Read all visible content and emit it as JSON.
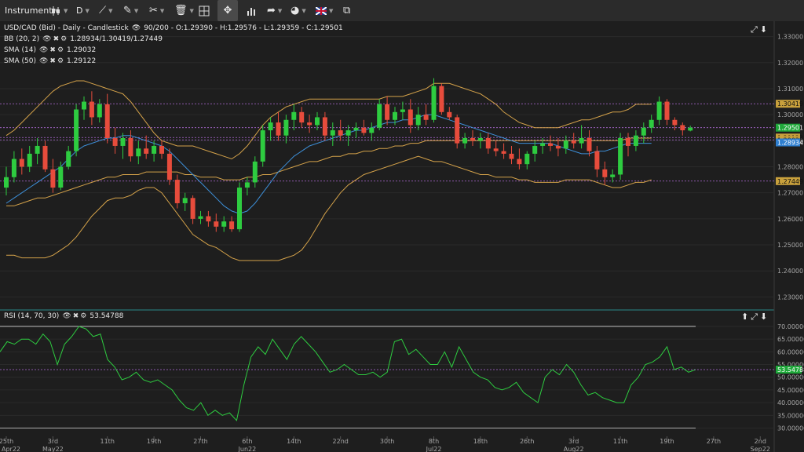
{
  "toolbar": {
    "instrument_label": "Instrument",
    "timeframe_label": "D"
  },
  "legend": {
    "main_title": "USD/CAD (Bid) - Daily - Candlestick",
    "main_values": "90/200 - O:1.29390 - H:1.29576 - L:1.29359 - C:1.29501",
    "bb_label": "BB (20, 2)",
    "bb_values": "1.28934/1.30419/1.27449",
    "sma14_label": "SMA (14)",
    "sma14_value": "1.29032",
    "sma50_label": "SMA (50)",
    "sma50_value": "1.29122",
    "rsi_label": "RSI (14, 70, 30)",
    "rsi_value": "53.54788"
  },
  "colors": {
    "background": "#1e1e1e",
    "up_candle": "#2ecc40",
    "down_candle": "#e74c3c",
    "bollinger": "#d4a24a",
    "sma14": "#3d8fd8",
    "sma50": "#d4a24a",
    "rsi_line": "#2ecc40",
    "price_level_line": "#b06ad8"
  },
  "chart_data": {
    "type": "candlestick",
    "title": "USD/CAD (Bid) - Daily - Candlestick",
    "price_axis": {
      "range": [
        1.225,
        1.335
      ],
      "ticks": [
        "1.33000",
        "1.32000",
        "1.31000",
        "1.30000",
        "1.29000",
        "1.28000",
        "1.27000",
        "1.26000",
        "1.25000",
        "1.24000",
        "1.23000"
      ]
    },
    "price_tags": [
      {
        "value": 1.30419,
        "label": "1.30419",
        "bg": "#c8a03c",
        "fg": "#111111"
      },
      {
        "value": 1.29501,
        "label": "1.29501",
        "bg": "#1fa83a",
        "fg": "#ffffff"
      },
      {
        "value": 1.29122,
        "label": "1.29122",
        "bg": "#c8a03c",
        "fg": "#111111"
      },
      {
        "value": 1.29032,
        "label": "1.29032",
        "bg": "#c8a03c",
        "fg": "#111111"
      },
      {
        "value": 1.28934,
        "label": "1.28934",
        "bg": "#2f7fd0",
        "fg": "#ffffff"
      },
      {
        "value": 1.27449,
        "label": "1.27449",
        "bg": "#c8a03c",
        "fg": "#111111"
      }
    ],
    "level_lines": [
      1.30419,
      1.29501,
      1.29122,
      1.29032,
      1.27449
    ],
    "candles": [
      [
        1.272,
        1.28,
        1.269,
        1.276
      ],
      [
        1.276,
        1.286,
        1.274,
        1.283
      ],
      [
        1.283,
        1.287,
        1.277,
        1.28
      ],
      [
        1.28,
        1.288,
        1.278,
        1.285
      ],
      [
        1.285,
        1.291,
        1.281,
        1.288
      ],
      [
        1.288,
        1.29,
        1.278,
        1.279
      ],
      [
        1.279,
        1.283,
        1.27,
        1.272
      ],
      [
        1.272,
        1.282,
        1.271,
        1.28
      ],
      [
        1.28,
        1.288,
        1.279,
        1.286
      ],
      [
        1.286,
        1.304,
        1.284,
        1.302
      ],
      [
        1.302,
        1.307,
        1.298,
        1.305
      ],
      [
        1.305,
        1.309,
        1.296,
        1.299
      ],
      [
        1.299,
        1.306,
        1.297,
        1.304
      ],
      [
        1.304,
        1.308,
        1.289,
        1.291
      ],
      [
        1.291,
        1.295,
        1.285,
        1.288
      ],
      [
        1.288,
        1.293,
        1.283,
        1.291
      ],
      [
        1.291,
        1.294,
        1.282,
        1.284
      ],
      [
        1.284,
        1.29,
        1.281,
        1.287
      ],
      [
        1.287,
        1.292,
        1.283,
        1.285
      ],
      [
        1.285,
        1.29,
        1.282,
        1.288
      ],
      [
        1.288,
        1.29,
        1.283,
        1.285
      ],
      [
        1.285,
        1.287,
        1.273,
        1.275
      ],
      [
        1.275,
        1.277,
        1.264,
        1.266
      ],
      [
        1.266,
        1.27,
        1.263,
        1.268
      ],
      [
        1.268,
        1.269,
        1.258,
        1.26
      ],
      [
        1.26,
        1.263,
        1.258,
        1.261
      ],
      [
        1.261,
        1.263,
        1.257,
        1.259
      ],
      [
        1.259,
        1.262,
        1.255,
        1.257
      ],
      [
        1.257,
        1.261,
        1.255,
        1.259
      ],
      [
        1.259,
        1.261,
        1.255,
        1.256
      ],
      [
        1.256,
        1.274,
        1.255,
        1.272
      ],
      [
        1.272,
        1.276,
        1.269,
        1.274
      ],
      [
        1.274,
        1.284,
        1.272,
        1.282
      ],
      [
        1.282,
        1.296,
        1.28,
        1.294
      ],
      [
        1.294,
        1.299,
        1.29,
        1.297
      ],
      [
        1.297,
        1.301,
        1.29,
        1.292
      ],
      [
        1.292,
        1.3,
        1.289,
        1.298
      ],
      [
        1.298,
        1.304,
        1.294,
        1.301
      ],
      [
        1.301,
        1.303,
        1.295,
        1.297
      ],
      [
        1.297,
        1.3,
        1.293,
        1.296
      ],
      [
        1.296,
        1.301,
        1.294,
        1.299
      ],
      [
        1.299,
        1.301,
        1.29,
        1.292
      ],
      [
        1.292,
        1.297,
        1.288,
        1.294
      ],
      [
        1.294,
        1.298,
        1.29,
        1.292
      ],
      [
        1.292,
        1.296,
        1.288,
        1.294
      ],
      [
        1.294,
        1.297,
        1.291,
        1.295
      ],
      [
        1.295,
        1.298,
        1.292,
        1.293
      ],
      [
        1.293,
        1.297,
        1.29,
        1.295
      ],
      [
        1.295,
        1.306,
        1.294,
        1.304
      ],
      [
        1.304,
        1.307,
        1.296,
        1.298
      ],
      [
        1.298,
        1.303,
        1.296,
        1.301
      ],
      [
        1.301,
        1.305,
        1.298,
        1.302
      ],
      [
        1.302,
        1.306,
        1.293,
        1.296
      ],
      [
        1.296,
        1.303,
        1.294,
        1.3
      ],
      [
        1.3,
        1.304,
        1.296,
        1.298
      ],
      [
        1.298,
        1.314,
        1.297,
        1.311
      ],
      [
        1.311,
        1.312,
        1.3,
        1.301
      ],
      [
        1.301,
        1.303,
        1.298,
        1.299
      ],
      [
        1.299,
        1.3,
        1.287,
        1.289
      ],
      [
        1.289,
        1.293,
        1.287,
        1.291
      ],
      [
        1.291,
        1.294,
        1.288,
        1.29
      ],
      [
        1.29,
        1.293,
        1.287,
        1.291
      ],
      [
        1.291,
        1.293,
        1.285,
        1.287
      ],
      [
        1.287,
        1.29,
        1.284,
        1.286
      ],
      [
        1.286,
        1.289,
        1.283,
        1.285
      ],
      [
        1.285,
        1.288,
        1.281,
        1.283
      ],
      [
        1.283,
        1.287,
        1.279,
        1.281
      ],
      [
        1.281,
        1.286,
        1.279,
        1.285
      ],
      [
        1.285,
        1.29,
        1.282,
        1.288
      ],
      [
        1.288,
        1.291,
        1.285,
        1.289
      ],
      [
        1.289,
        1.292,
        1.286,
        1.288
      ],
      [
        1.288,
        1.291,
        1.284,
        1.287
      ],
      [
        1.287,
        1.292,
        1.285,
        1.29
      ],
      [
        1.29,
        1.293,
        1.287,
        1.289
      ],
      [
        1.289,
        1.296,
        1.287,
        1.291
      ],
      [
        1.291,
        1.294,
        1.284,
        1.286
      ],
      [
        1.286,
        1.288,
        1.276,
        1.279
      ],
      [
        1.279,
        1.282,
        1.273,
        1.276
      ],
      [
        1.276,
        1.279,
        1.274,
        1.277
      ],
      [
        1.277,
        1.293,
        1.275,
        1.291
      ],
      [
        1.291,
        1.293,
        1.284,
        1.288
      ],
      [
        1.288,
        1.294,
        1.286,
        1.292
      ],
      [
        1.292,
        1.297,
        1.289,
        1.295
      ],
      [
        1.295,
        1.3,
        1.293,
        1.298
      ],
      [
        1.298,
        1.307,
        1.296,
        1.305
      ],
      [
        1.305,
        1.306,
        1.296,
        1.298
      ],
      [
        1.298,
        1.299,
        1.294,
        1.296
      ],
      [
        1.296,
        1.297,
        1.292,
        1.294
      ],
      [
        1.2939,
        1.29576,
        1.29359,
        1.29501
      ]
    ],
    "bollinger_upper": [
      1.292,
      1.294,
      1.297,
      1.3,
      1.303,
      1.306,
      1.309,
      1.311,
      1.312,
      1.313,
      1.313,
      1.312,
      1.311,
      1.31,
      1.309,
      1.308,
      1.305,
      1.301,
      1.297,
      1.293,
      1.29,
      1.289,
      1.288,
      1.288,
      1.288,
      1.287,
      1.286,
      1.285,
      1.284,
      1.283,
      1.285,
      1.288,
      1.292,
      1.296,
      1.299,
      1.301,
      1.303,
      1.304,
      1.305,
      1.306,
      1.306,
      1.306,
      1.306,
      1.306,
      1.306,
      1.306,
      1.306,
      1.306,
      1.306,
      1.307,
      1.307,
      1.307,
      1.308,
      1.309,
      1.31,
      1.312,
      1.312,
      1.312,
      1.311,
      1.31,
      1.309,
      1.308,
      1.306,
      1.304,
      1.301,
      1.299,
      1.297,
      1.296,
      1.295,
      1.295,
      1.295,
      1.295,
      1.296,
      1.297,
      1.298,
      1.298,
      1.299,
      1.3,
      1.301,
      1.301,
      1.302,
      1.304,
      1.304,
      1.304
    ],
    "bollinger_lower": [
      1.246,
      1.246,
      1.245,
      1.245,
      1.245,
      1.245,
      1.246,
      1.248,
      1.25,
      1.253,
      1.257,
      1.261,
      1.264,
      1.267,
      1.268,
      1.268,
      1.269,
      1.271,
      1.272,
      1.272,
      1.27,
      1.266,
      1.262,
      1.258,
      1.254,
      1.252,
      1.25,
      1.249,
      1.247,
      1.245,
      1.244,
      1.244,
      1.244,
      1.244,
      1.244,
      1.244,
      1.245,
      1.246,
      1.248,
      1.252,
      1.257,
      1.262,
      1.266,
      1.27,
      1.273,
      1.275,
      1.277,
      1.278,
      1.279,
      1.28,
      1.281,
      1.282,
      1.283,
      1.284,
      1.283,
      1.282,
      1.282,
      1.281,
      1.28,
      1.279,
      1.278,
      1.277,
      1.277,
      1.276,
      1.276,
      1.276,
      1.275,
      1.275,
      1.274,
      1.274,
      1.274,
      1.274,
      1.275,
      1.275,
      1.275,
      1.275,
      1.274,
      1.273,
      1.272,
      1.272,
      1.273,
      1.274,
      1.274,
      1.275
    ],
    "sma14": [
      1.266,
      1.268,
      1.27,
      1.272,
      1.274,
      1.276,
      1.278,
      1.28,
      1.283,
      1.286,
      1.288,
      1.289,
      1.29,
      1.291,
      1.291,
      1.292,
      1.292,
      1.291,
      1.29,
      1.289,
      1.288,
      1.286,
      1.283,
      1.28,
      1.277,
      1.274,
      1.271,
      1.268,
      1.265,
      1.263,
      1.262,
      1.263,
      1.266,
      1.27,
      1.274,
      1.278,
      1.281,
      1.284,
      1.286,
      1.288,
      1.289,
      1.29,
      1.291,
      1.292,
      1.293,
      1.294,
      1.294,
      1.295,
      1.296,
      1.297,
      1.297,
      1.298,
      1.298,
      1.299,
      1.3,
      1.3,
      1.299,
      1.298,
      1.297,
      1.296,
      1.295,
      1.294,
      1.293,
      1.292,
      1.291,
      1.29,
      1.289,
      1.289,
      1.289,
      1.289,
      1.289,
      1.288,
      1.287,
      1.286,
      1.285,
      1.285,
      1.286,
      1.286,
      1.287,
      1.288,
      1.289,
      1.289,
      1.289,
      1.289
    ],
    "sma50": [
      1.265,
      1.265,
      1.266,
      1.267,
      1.268,
      1.268,
      1.269,
      1.27,
      1.271,
      1.272,
      1.273,
      1.274,
      1.275,
      1.276,
      1.276,
      1.277,
      1.277,
      1.277,
      1.278,
      1.278,
      1.278,
      1.278,
      1.278,
      1.277,
      1.277,
      1.276,
      1.276,
      1.276,
      1.275,
      1.275,
      1.275,
      1.276,
      1.276,
      1.277,
      1.277,
      1.278,
      1.279,
      1.28,
      1.281,
      1.282,
      1.282,
      1.283,
      1.284,
      1.284,
      1.285,
      1.285,
      1.286,
      1.286,
      1.287,
      1.287,
      1.288,
      1.288,
      1.289,
      1.289,
      1.29,
      1.29,
      1.29,
      1.29,
      1.29,
      1.29,
      1.29,
      1.29,
      1.29,
      1.29,
      1.29,
      1.29,
      1.29,
      1.29,
      1.29,
      1.29,
      1.29,
      1.29,
      1.29,
      1.29,
      1.29,
      1.29,
      1.29,
      1.29,
      1.29,
      1.29,
      1.291,
      1.291,
      1.291,
      1.291
    ],
    "rsi": {
      "range": [
        28,
        74
      ],
      "ticks": [
        "70.00000",
        "65.00000",
        "60.00000",
        "55.00000",
        "50.00000",
        "45.00000",
        "40.00000",
        "35.00000",
        "30.00000"
      ],
      "overbought": 70,
      "oversold": 30,
      "current_label": "53.54788",
      "values": [
        60,
        64,
        63,
        65,
        65,
        63,
        67,
        64,
        55,
        63,
        66,
        70,
        69,
        66,
        67,
        57,
        54,
        49,
        50,
        52,
        49,
        48,
        49,
        47,
        45,
        41,
        38,
        37,
        40,
        35,
        37,
        35,
        36,
        33,
        47,
        58,
        62,
        59,
        65,
        61,
        57,
        63,
        66,
        63,
        60,
        56,
        52,
        53,
        55,
        53,
        51,
        51,
        52,
        50,
        52,
        64,
        65,
        59,
        61,
        58,
        55,
        55,
        60,
        54,
        62,
        57,
        52,
        50,
        49,
        46,
        45,
        46,
        48,
        44,
        42,
        40,
        50,
        53,
        51,
        55,
        52,
        47,
        43,
        44,
        42,
        41,
        40,
        40,
        47,
        50,
        55,
        56,
        58,
        62,
        53,
        54,
        52,
        53
      ]
    },
    "x_ticks": [
      {
        "idx": 0,
        "label": "25th"
      },
      {
        "idx": 6,
        "label": "3rd"
      },
      {
        "idx": 13,
        "label": "11th"
      },
      {
        "idx": 19,
        "label": "19th"
      },
      {
        "idx": 25,
        "label": "27th"
      },
      {
        "idx": 31,
        "label": "6th"
      },
      {
        "idx": 37,
        "label": "14th"
      },
      {
        "idx": 43,
        "label": "22nd"
      },
      {
        "idx": 49,
        "label": "30th"
      },
      {
        "idx": 55,
        "label": "8th"
      },
      {
        "idx": 61,
        "label": "18th"
      },
      {
        "idx": 67,
        "label": "26th"
      },
      {
        "idx": 73,
        "label": "3rd"
      },
      {
        "idx": 79,
        "label": "11th"
      },
      {
        "idx": 85,
        "label": "19th"
      },
      {
        "idx": 91,
        "label": "27th"
      },
      {
        "idx": 97,
        "label": "2nd"
      }
    ],
    "x_month_labels": [
      {
        "idx": 0,
        "label": "Apr22"
      },
      {
        "idx": 6,
        "label": "May22"
      },
      {
        "idx": 31,
        "label": "Jun22"
      },
      {
        "idx": 55,
        "label": "Jul22"
      },
      {
        "idx": 73,
        "label": "Aug22"
      },
      {
        "idx": 97,
        "label": "Sep22"
      }
    ]
  }
}
